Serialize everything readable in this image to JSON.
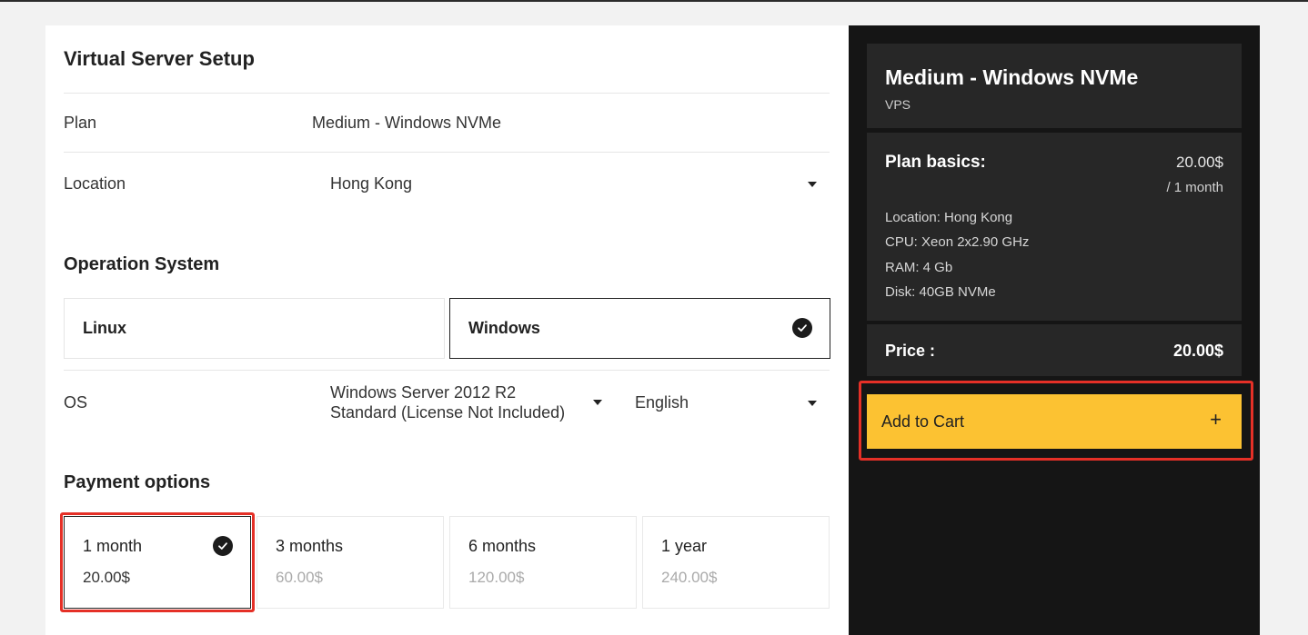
{
  "setup": {
    "title": "Virtual Server Setup",
    "plan_label": "Plan",
    "plan_value": "Medium - Windows NVMe",
    "location_label": "Location",
    "location_value": "Hong Kong"
  },
  "os_section": {
    "title": "Operation System",
    "options": [
      "Linux",
      "Windows"
    ],
    "selected": "Windows",
    "os_label": "OS",
    "os_value_line1": "Windows Server 2012 R2",
    "os_value_line2": "Standard (License Not Included)",
    "language_value": "English"
  },
  "payment": {
    "title": "Payment options",
    "options": [
      {
        "term": "1 month",
        "price": "20.00$",
        "selected": true
      },
      {
        "term": "3 months",
        "price": "60.00$",
        "selected": false
      },
      {
        "term": "6 months",
        "price": "120.00$",
        "selected": false
      },
      {
        "term": "1 year",
        "price": "240.00$",
        "selected": false
      }
    ]
  },
  "summary": {
    "name": "Medium - Windows NVMe",
    "type": "VPS",
    "basics_title": "Plan basics:",
    "basics_price": "20.00$",
    "basics_period": "/ 1 month",
    "specs": [
      "Location: Hong Kong",
      "CPU: Xeon 2x2.90 GHz",
      "RAM: 4 Gb",
      "Disk: 40GB NVMe"
    ],
    "price_label": "Price :",
    "price_value": "20.00$",
    "cart_label": "Add to Cart",
    "cart_icon": "+"
  },
  "colors": {
    "accent_yellow": "#fcc232",
    "highlight_red": "#e53027",
    "sidebar_bg": "#151515",
    "card_bg": "#272727"
  }
}
